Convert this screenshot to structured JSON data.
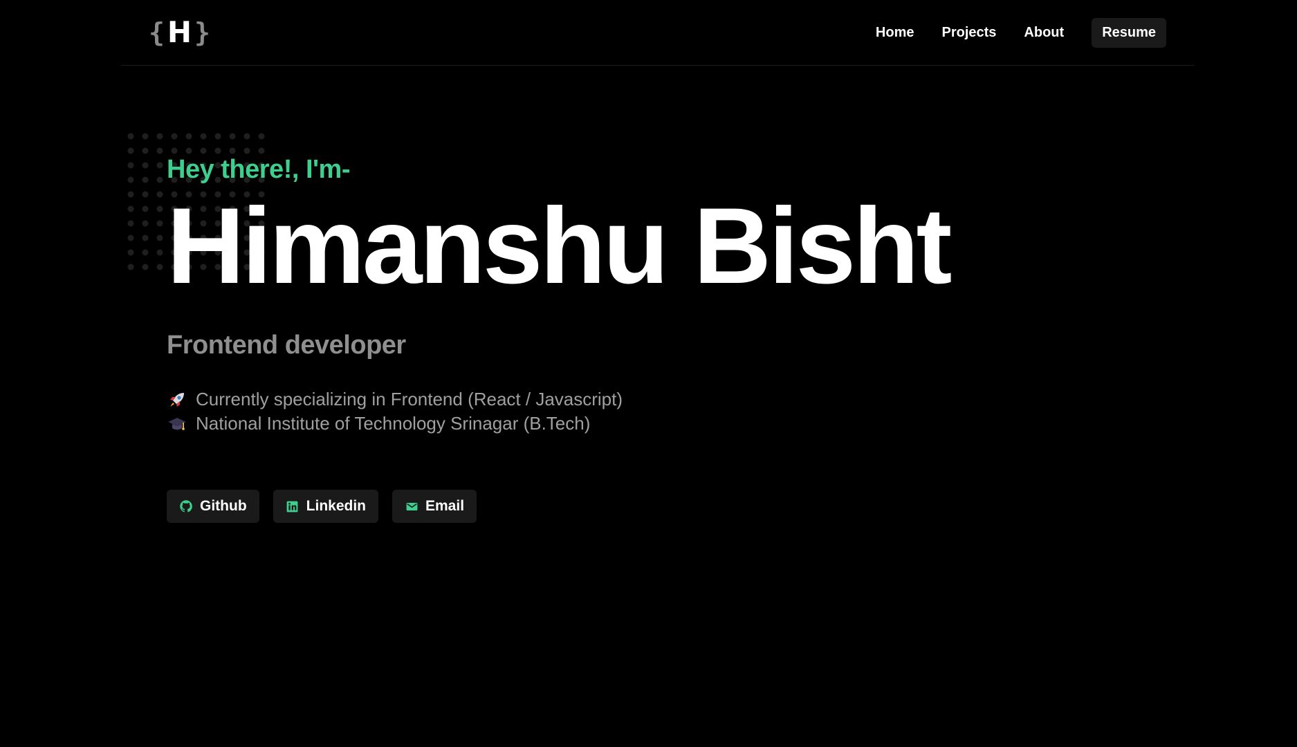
{
  "header": {
    "logo": {
      "open_brace": "{",
      "letter": "H",
      "close_brace": "}"
    },
    "nav": [
      {
        "label": "Home"
      },
      {
        "label": "Projects"
      },
      {
        "label": "About"
      }
    ],
    "resume_label": "Resume"
  },
  "hero": {
    "greeting": "Hey there!, I'm-",
    "name": "Himanshu Bisht",
    "role": "Frontend developer",
    "bio": [
      {
        "icon": "rocket-icon",
        "text": "Currently specializing in Frontend (React / Javascript)"
      },
      {
        "icon": "graduation-cap-icon",
        "text": "National Institute of Technology Srinagar (B.Tech)"
      }
    ],
    "socials": [
      {
        "icon": "github-icon",
        "label": "Github"
      },
      {
        "icon": "linkedin-icon",
        "label": "Linkedin"
      },
      {
        "icon": "mail-icon",
        "label": "Email"
      }
    ]
  },
  "colors": {
    "background": "#000000",
    "accent": "#3ecf8e",
    "muted_text": "#a0a0a0",
    "button_bg": "#1a1a1a",
    "dot": "#1f1f1f"
  }
}
